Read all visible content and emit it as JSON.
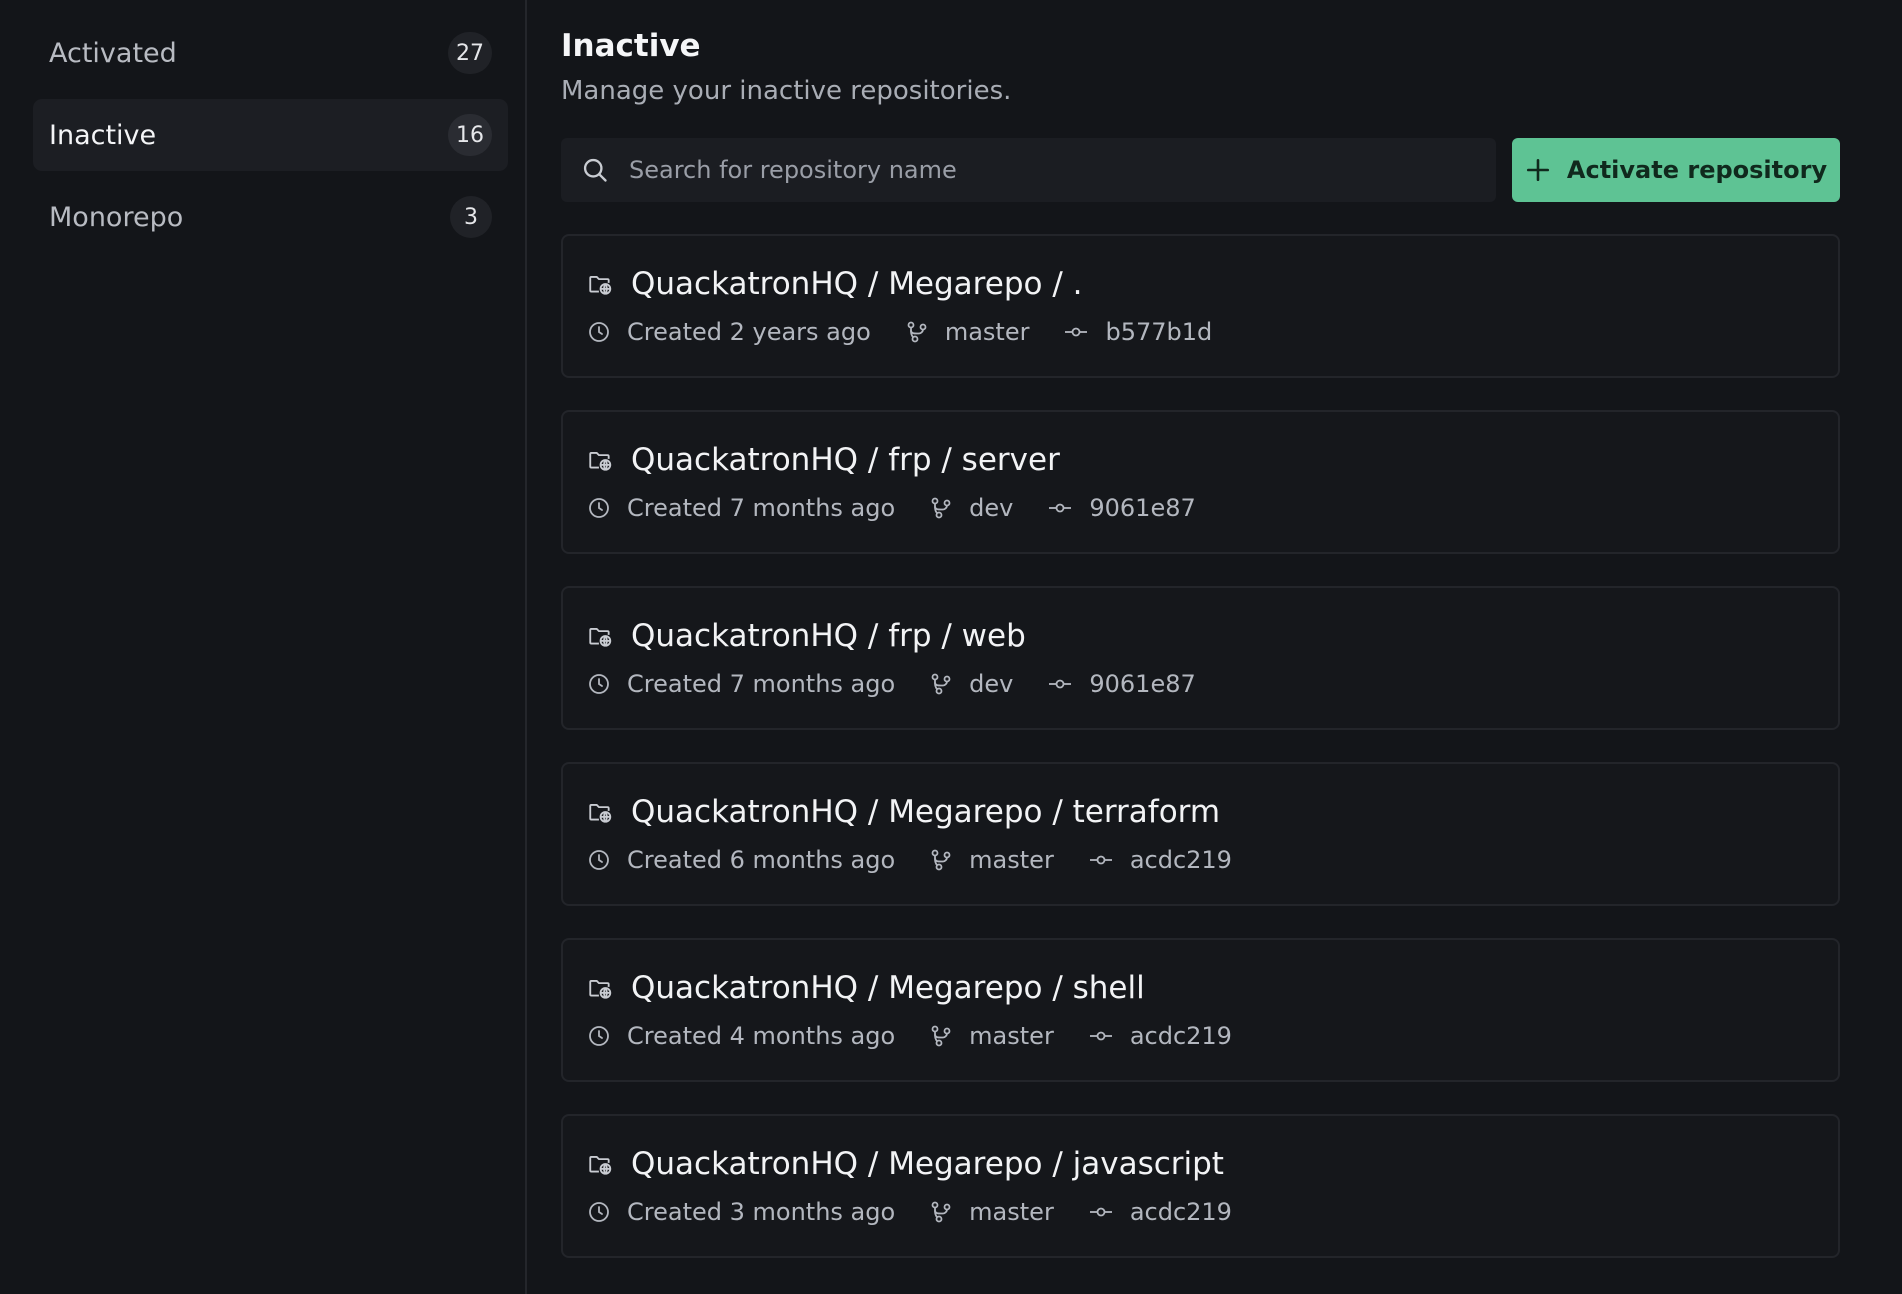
{
  "sidebar": {
    "items": [
      {
        "label": "Activated",
        "count": "27",
        "active": false
      },
      {
        "label": "Inactive",
        "count": "16",
        "active": true
      },
      {
        "label": "Monorepo",
        "count": "3",
        "active": false
      }
    ]
  },
  "header": {
    "title": "Inactive",
    "subtitle": "Manage your inactive repositories."
  },
  "search": {
    "placeholder": "Search for repository name",
    "value": ""
  },
  "actions": {
    "activate_label": "Activate repository"
  },
  "repos": [
    {
      "name": "QuackatronHQ / Megarepo / .",
      "created": "Created 2 years ago",
      "branch": "master",
      "commit": "b577b1d"
    },
    {
      "name": "QuackatronHQ / frp / server",
      "created": "Created 7 months ago",
      "branch": "dev",
      "commit": "9061e87"
    },
    {
      "name": "QuackatronHQ / frp / web",
      "created": "Created 7 months ago",
      "branch": "dev",
      "commit": "9061e87"
    },
    {
      "name": "QuackatronHQ / Megarepo / terraform",
      "created": "Created 6 months ago",
      "branch": "master",
      "commit": "acdc219"
    },
    {
      "name": "QuackatronHQ / Megarepo / shell",
      "created": "Created 4 months ago",
      "branch": "master",
      "commit": "acdc219"
    },
    {
      "name": "QuackatronHQ / Megarepo / javascript",
      "created": "Created 3 months ago",
      "branch": "master",
      "commit": "acdc219"
    }
  ],
  "icons": {
    "repo": "folder-globe-icon",
    "created": "clock-icon",
    "branch": "git-branch-icon",
    "commit": "git-commit-icon",
    "search": "search-icon",
    "activate": "plus-icon"
  },
  "colors": {
    "background": "#131519",
    "accent": "#5ec394",
    "card_border": "#23252a"
  }
}
